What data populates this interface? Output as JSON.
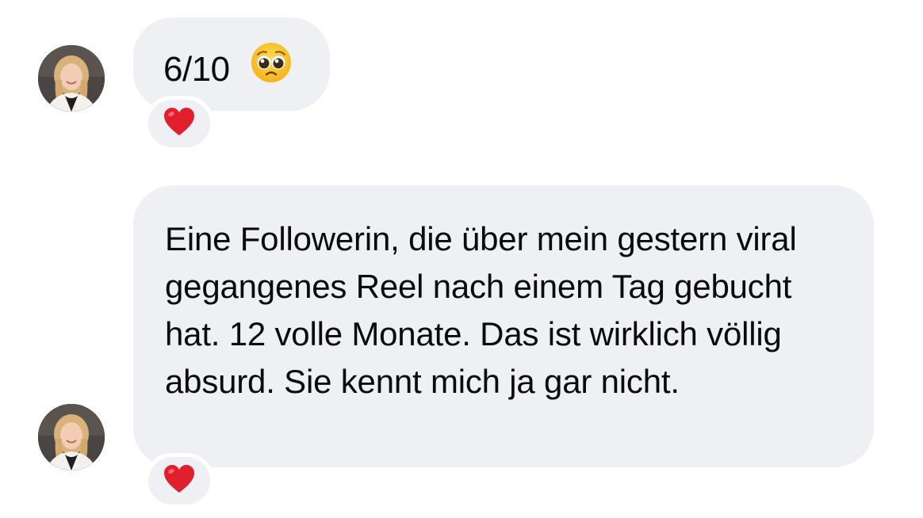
{
  "conversation": {
    "messages": [
      {
        "text": "6/10",
        "emoji": "pleading-face",
        "reaction": "heart"
      },
      {
        "text": "Eine Followerin, die über mein gestern viral gegangenes Reel nach einem Tag gebucht hat. 12 volle Monate. Das ist wirklich völlig absurd. Sie kennt mich ja gar nicht.",
        "reaction": "heart"
      }
    ]
  },
  "colors": {
    "bubble_background": "#eef0f3",
    "page_background": "#ffffff",
    "text": "#0a0a0a",
    "heart": "#e0202e"
  }
}
